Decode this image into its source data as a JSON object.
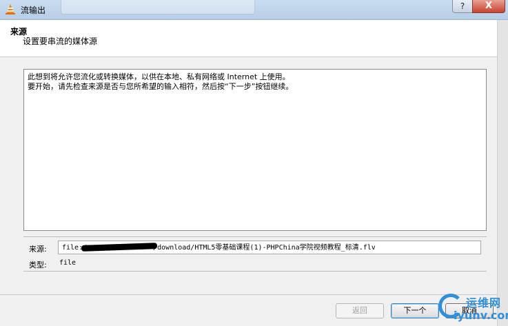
{
  "window": {
    "title": "流输出",
    "help_label": "?",
    "close_label": "X"
  },
  "header": {
    "title": "来源",
    "subtitle": "设置要串流的媒体源"
  },
  "description": {
    "line1": "此想到将允许您流化或转换媒体，以供在本地、私有网络或 Internet 上使用。",
    "line2": "要开始，请先检查来源是否与您所希望的输入相符，然后按“下一步”按钮继续。"
  },
  "source": {
    "label": "来源:",
    "value_prefix": "file:/",
    "value_suffix": "/download/HTML5零基础课程(1)-PHPChina学院视频教程_标清.flv"
  },
  "type": {
    "label": "类型:",
    "value": "file"
  },
  "buttons": {
    "back": "返回",
    "next": "下一个",
    "cancel": "取消"
  },
  "watermark": {
    "top": "运维网",
    "bottom": "iyunv.com"
  },
  "colors": {
    "titlebar": "#c9dcef",
    "close": "#c7432f",
    "watermark": "#2f8fd8"
  }
}
